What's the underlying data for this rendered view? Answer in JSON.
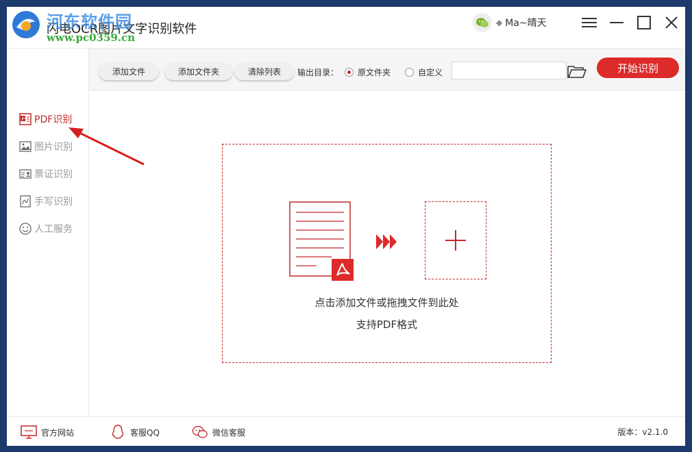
{
  "watermark": {
    "site_name": "河东软件园",
    "url": "www.pc0359.cn"
  },
  "app": {
    "title": "闪电OCR图片文字识别软件"
  },
  "user": {
    "name": "Ma~晴天"
  },
  "window_controls": [
    "menu-icon",
    "minimize-icon",
    "maximize-icon",
    "close-icon"
  ],
  "sidebar": {
    "items": [
      {
        "label": "PDF识别",
        "icon": "pdf-icon",
        "active": true
      },
      {
        "label": "图片识别",
        "icon": "image-icon",
        "active": false
      },
      {
        "label": "票证识别",
        "icon": "id-card-icon",
        "active": false
      },
      {
        "label": "手写识别",
        "icon": "handwriting-icon",
        "active": false
      },
      {
        "label": "人工服务",
        "icon": "smiley-icon",
        "active": false
      }
    ]
  },
  "toolbar": {
    "add_file": "添加文件",
    "add_folder": "添加文件夹",
    "clear_list": "清除列表",
    "output_label": "输出目录：",
    "radio_original": "原文件夹",
    "radio_custom": "自定义",
    "selected_output": "原文件夹",
    "path_value": "",
    "start_button": "开始识别"
  },
  "dropzone": {
    "hint": "点击添加文件或拖拽文件到此处",
    "support": "支持PDF格式"
  },
  "footer": {
    "website": "官方网站",
    "qq": "客服QQ",
    "wechat": "微信客服",
    "version": "版本：v2.1.0"
  },
  "colors": {
    "accent": "#dd2a2a",
    "active_text": "#c0282a",
    "frame_bg": "#1c3a6b"
  }
}
